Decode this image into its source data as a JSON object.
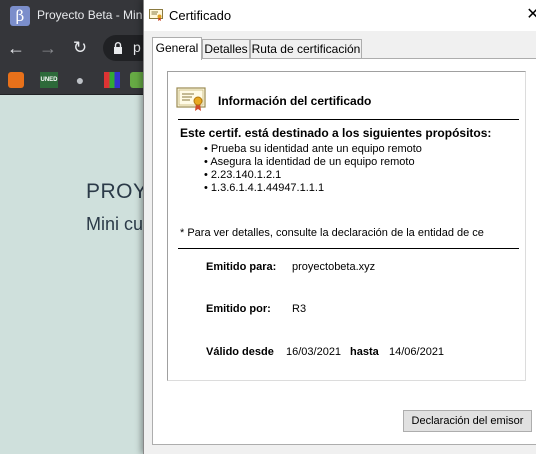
{
  "browser": {
    "tab_title": "Proyecto Beta - Min",
    "tab_favicon_glyph": "β",
    "omnibox_text": "p",
    "bookmarks": [
      "",
      "UNED",
      "",
      "",
      ""
    ],
    "page": {
      "heading": "PROY",
      "subheading": "Mini cu"
    }
  },
  "dialog": {
    "title": "Certificado",
    "close_glyph": "✕",
    "tabs": [
      {
        "label": "General",
        "active": true
      },
      {
        "label": "Detalles",
        "active": false
      },
      {
        "label": "Ruta de certificación",
        "active": false
      }
    ],
    "info_title": "Información del certificado",
    "purpose_heading": "Este certif. está destinado a los siguientes propósitos:",
    "purposes": [
      "Prueba su identidad ante un equipo remoto",
      "Asegura la identidad de un equipo remoto",
      "2.23.140.1.2.1",
      "1.3.6.1.4.1.44947.1.1.1"
    ],
    "details_note": "* Para ver detalles, consulte la declaración de la entidad de ce",
    "issued_to_label": "Emitido para:",
    "issued_to_value": "proyectobeta.xyz",
    "issued_by_label": "Emitido por:",
    "issued_by_value": "R3",
    "valid_from_label": "Válido desde",
    "valid_from_value": "16/03/2021",
    "valid_until_label": "hasta",
    "valid_until_value": "14/06/2021",
    "issuer_statement_button": "Declaración del emisor"
  },
  "colors": {
    "browser_dark": "#202124",
    "browser_toolbar": "#35363a",
    "page_background": "#cfe0dc",
    "dialog_background": "#f0f0f0"
  },
  "icons": {
    "back": "arrow-left-icon",
    "forward": "arrow-right-icon",
    "reload": "reload-icon",
    "lock": "lock-icon",
    "certificate": "certificate-icon",
    "close": "close-icon"
  }
}
